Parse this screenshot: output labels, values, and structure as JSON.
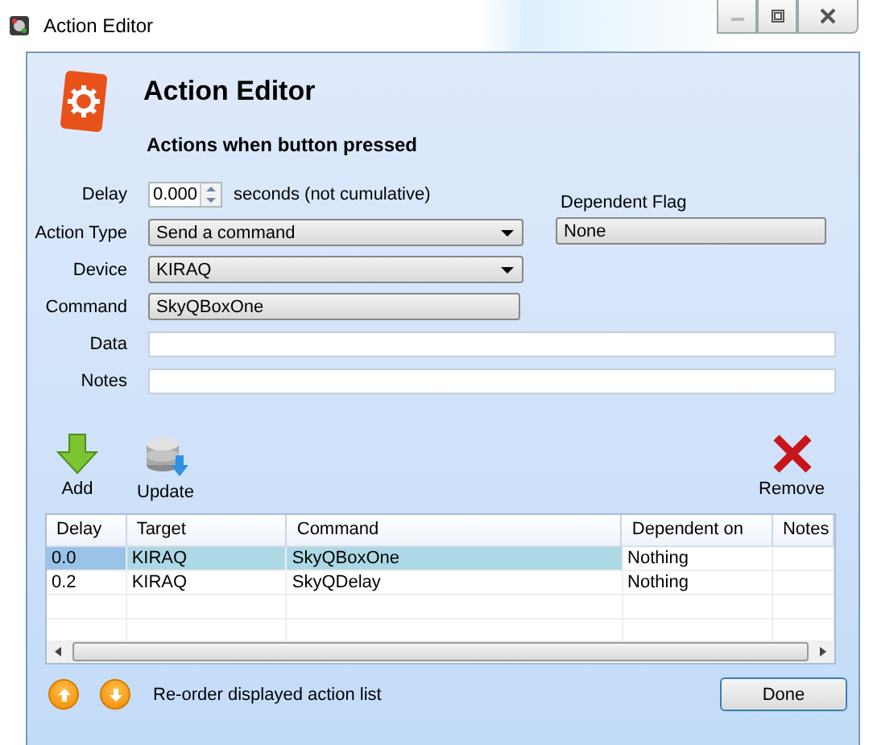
{
  "window": {
    "title": "Action Editor"
  },
  "header": {
    "title": "Action Editor",
    "subtitle": "Actions when button pressed"
  },
  "form": {
    "delay": {
      "label": "Delay",
      "value": "0.000",
      "unit": "seconds (not cumulative)"
    },
    "action_type": {
      "label": "Action Type",
      "value": "Send a command"
    },
    "device": {
      "label": "Device",
      "value": "KIRAQ"
    },
    "command": {
      "label": "Command",
      "value": "SkyQBoxOne"
    },
    "data": {
      "label": "Data"
    },
    "notes": {
      "label": "Notes"
    },
    "dependent_flag": {
      "label": "Dependent Flag",
      "value": "None"
    }
  },
  "toolbar": [
    {
      "kind": "add",
      "label": "Add"
    },
    {
      "kind": "update",
      "label": "Update"
    },
    {
      "kind": "remove",
      "label": "Remove"
    }
  ],
  "table": {
    "columns": [
      "Delay",
      "Target",
      "Command",
      "Dependent on",
      "Notes"
    ],
    "rows": [
      {
        "selected": true,
        "cells": [
          "0.0",
          "KIRAQ",
          "SkyQBoxOne",
          "Nothing",
          ""
        ]
      },
      {
        "selected": false,
        "cells": [
          "0.2",
          "KIRAQ",
          "SkyQDelay",
          "Nothing",
          ""
        ]
      }
    ]
  },
  "footer": {
    "reorder_text": "Re-order displayed action list",
    "done": "Done"
  }
}
